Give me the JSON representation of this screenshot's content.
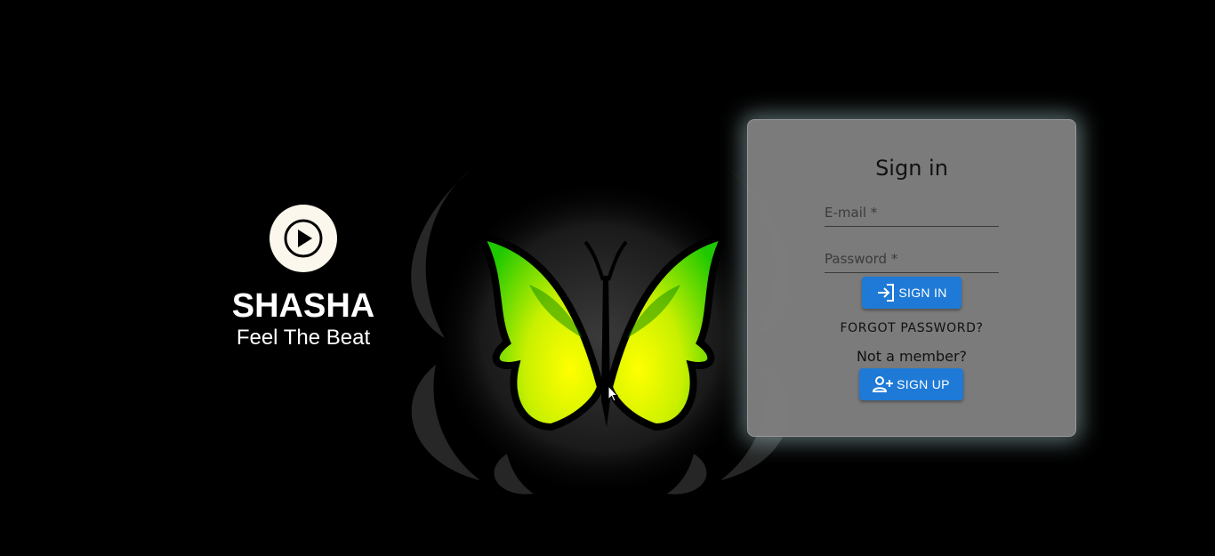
{
  "brand": {
    "name": "SHASHA",
    "tagline": "Feel The Beat",
    "logo_icon": "play-circle-icon"
  },
  "login": {
    "title": "Sign in",
    "email_placeholder": "E-mail *",
    "email_value": "",
    "password_placeholder": "Password *",
    "password_value": "",
    "signin_label": "SIGN IN",
    "signin_icon": "login-icon",
    "forgot_label": "FORGOT PASSWORD?",
    "not_member_text": "Not a member?",
    "signup_label": "SIGN UP",
    "signup_icon": "person-add-icon"
  },
  "colors": {
    "background": "#000000",
    "card": "#808080",
    "button": "#1e7ad6",
    "logo_bg": "#fbf7ec"
  }
}
